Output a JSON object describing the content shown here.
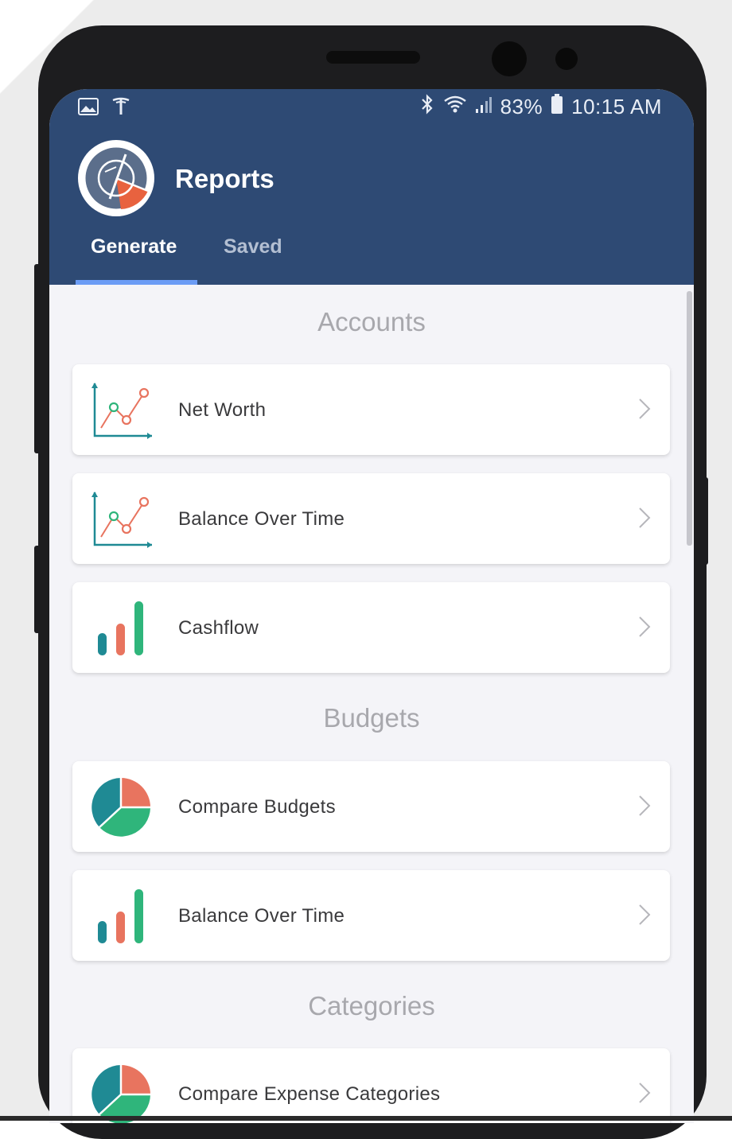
{
  "status_bar": {
    "battery_percent": "83%",
    "time": "10:15 AM",
    "icons_left": [
      "image-icon",
      "antenna-icon"
    ],
    "icons_right": [
      "bluetooth-icon",
      "wifi-icon",
      "signal-icon",
      "battery-icon"
    ]
  },
  "app": {
    "title": "Reports",
    "logo_icon": "reports-logo-icon"
  },
  "tabs": [
    {
      "label": "Generate",
      "active": true
    },
    {
      "label": "Saved",
      "active": false
    }
  ],
  "sections": [
    {
      "title": "Accounts",
      "items": [
        {
          "label": "Net Worth",
          "icon": "line-chart-icon"
        },
        {
          "label": "Balance Over Time",
          "icon": "line-chart-icon"
        },
        {
          "label": "Cashflow",
          "icon": "bar-chart-icon"
        }
      ]
    },
    {
      "title": "Budgets",
      "items": [
        {
          "label": "Compare Budgets",
          "icon": "pie-chart-icon"
        },
        {
          "label": "Balance Over Time",
          "icon": "bar-chart-icon"
        }
      ]
    },
    {
      "title": "Categories",
      "items": [
        {
          "label": "Compare Expense Categories",
          "icon": "pie-chart-icon"
        }
      ]
    }
  ],
  "colors": {
    "header": "#2e4a74",
    "tab_indicator": "#6b9cf5",
    "accent_teal": "#1f8a94",
    "accent_green": "#2fb57b",
    "accent_coral": "#e8745f"
  }
}
